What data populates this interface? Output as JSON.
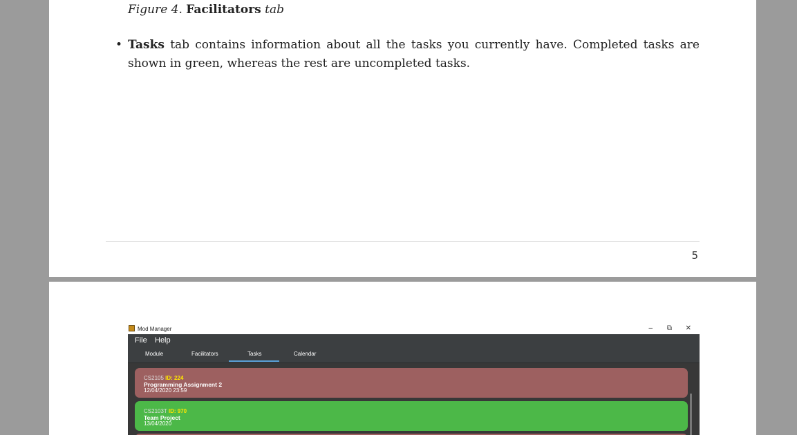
{
  "doc": {
    "caption": {
      "fig": "Figure 4.",
      "name": "Facilitators",
      "suffix": "tab"
    },
    "bullet": {
      "dot": "•",
      "bold": "Tasks",
      "text": " tab contains information about all the tasks you currently have. Completed tasks are shown in green, whereas the rest are uncompleted tasks."
    },
    "page_number": "5"
  },
  "app": {
    "window_title": "Mod Manager",
    "window_controls": {
      "minimize": "–",
      "maximize": "⧉",
      "close": "✕"
    },
    "menu": {
      "file": "File",
      "help": "Help"
    },
    "tabs": [
      "Module",
      "Facilitators",
      "Tasks",
      "Calendar"
    ],
    "active_tab": "Tasks",
    "tasks": [
      {
        "module": "CS2105",
        "id_label": "ID: 224",
        "name": "Programming Assignment 2",
        "date": "12/04/2020 23:59",
        "status": "uncompleted",
        "color": "#9d6060"
      },
      {
        "module": "CS2103T",
        "id_label": "ID: 970",
        "name": "Team Project",
        "date": "13/04/2020",
        "status": "completed",
        "color": "#4cb848"
      }
    ]
  },
  "colors": {
    "page_bg": "#9b9b9b",
    "app_dark": "#3c3f41",
    "task_uncompleted": "#9d6060",
    "task_completed": "#4cb848",
    "tab_underline": "#5aa0d8"
  }
}
